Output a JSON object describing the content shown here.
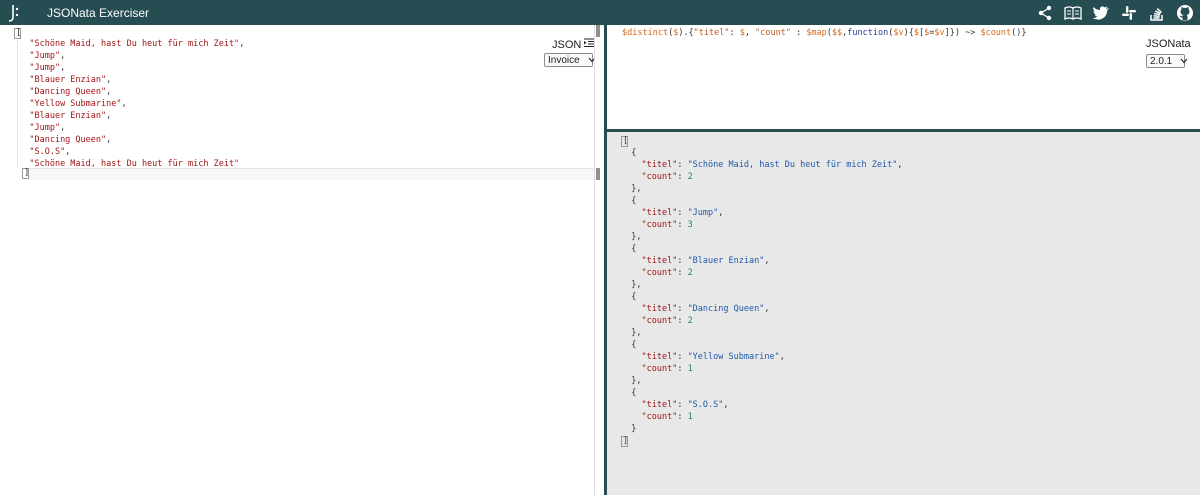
{
  "app": {
    "title": "JSONata Exerciser",
    "logo_text": "J:"
  },
  "header_icons": [
    "share-icon",
    "book-icon",
    "twitter-icon",
    "slack-icon",
    "stack-overflow-icon",
    "github-icon"
  ],
  "input": {
    "open_bracket": "[",
    "close_bracket": "]",
    "lines": [
      "\"Schöne Maid, hast Du heut für mich Zeit\",",
      "\"Jump\",",
      "\"Jump\",",
      "\"Blauer Enzian\",",
      "\"Dancing Queen\",",
      "\"Yellow Submarine\",",
      "\"Blauer Enzian\",",
      "\"Jump\",",
      "\"Dancing Queen\",",
      "\"S.O.S\",",
      "\"Schöne Maid, hast Du heut für mich Zeit\""
    ],
    "format_label": "JSON",
    "sample_select": "Invoice"
  },
  "expression": {
    "tokens": [
      {
        "t": "$distinct",
        "c": "var"
      },
      {
        "t": "(",
        "c": "plain"
      },
      {
        "t": "$",
        "c": "var"
      },
      {
        "t": ").{",
        "c": "plain"
      },
      {
        "t": "\"titel\"",
        "c": "str"
      },
      {
        "t": ": ",
        "c": "plain"
      },
      {
        "t": "$",
        "c": "var"
      },
      {
        "t": ", ",
        "c": "plain"
      },
      {
        "t": "\"count\"",
        "c": "str"
      },
      {
        "t": " : ",
        "c": "plain"
      },
      {
        "t": "$map",
        "c": "var"
      },
      {
        "t": "(",
        "c": "plain"
      },
      {
        "t": "$$",
        "c": "var"
      },
      {
        "t": ",",
        "c": "plain"
      },
      {
        "t": "function",
        "c": "fn"
      },
      {
        "t": "(",
        "c": "plain"
      },
      {
        "t": "$v",
        "c": "var"
      },
      {
        "t": "){",
        "c": "plain"
      },
      {
        "t": "$",
        "c": "var"
      },
      {
        "t": "[",
        "c": "plain"
      },
      {
        "t": "$",
        "c": "var"
      },
      {
        "t": "=",
        "c": "plain"
      },
      {
        "t": "$v",
        "c": "var"
      },
      {
        "t": "]}) ~> ",
        "c": "plain"
      },
      {
        "t": "$count",
        "c": "var"
      },
      {
        "t": "()}",
        "c": "plain"
      }
    ],
    "engine_label": "JSONata",
    "version_select": "2.0.1"
  },
  "result": {
    "open_bracket": "[",
    "close_bracket": "]",
    "items": [
      {
        "titel": "\"Schöne Maid, hast Du heut für mich Zeit\"",
        "count": "2"
      },
      {
        "titel": "\"Jump\"",
        "count": "3"
      },
      {
        "titel": "\"Blauer Enzian\"",
        "count": "2"
      },
      {
        "titel": "\"Dancing Queen\"",
        "count": "2"
      },
      {
        "titel": "\"Yellow Submarine\"",
        "count": "1"
      },
      {
        "titel": "\"S.O.S\"",
        "count": "1"
      }
    ],
    "key_titel": "\"titel\"",
    "key_count": "\"count\""
  }
}
